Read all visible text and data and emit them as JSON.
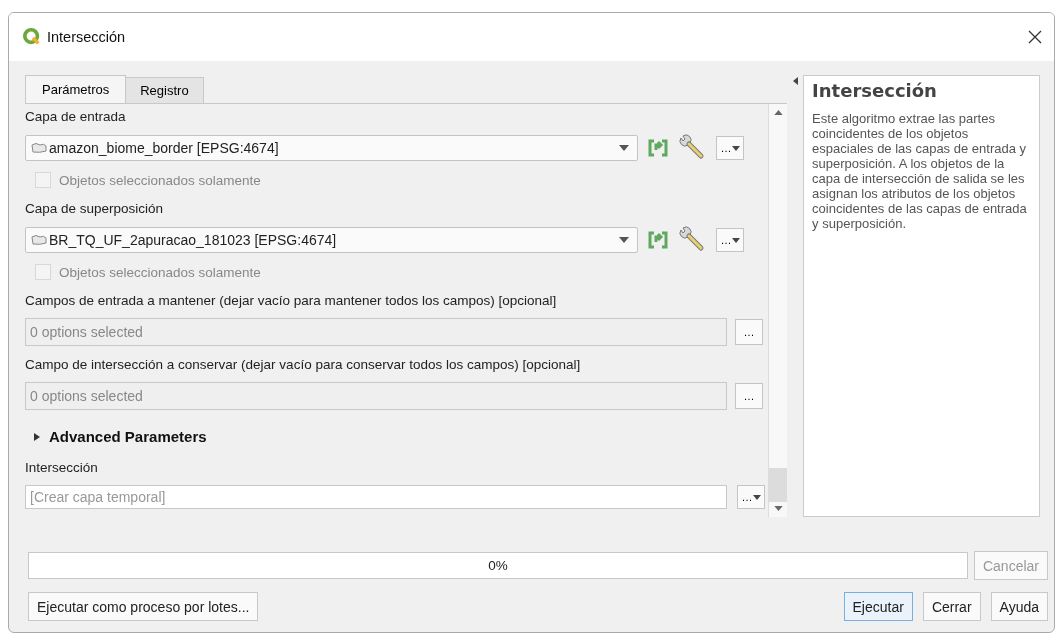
{
  "window": {
    "title": "Intersección"
  },
  "tabs": [
    {
      "label": "Parámetros",
      "selected": true
    },
    {
      "label": "Registro",
      "selected": false
    }
  ],
  "parameters": [
    {
      "kind": "layer",
      "label": "Capa de entrada",
      "value": "amazon_biome_border [EPSG:4674]",
      "button": "…",
      "selected_only": {
        "label": "Objetos seleccionados solamente",
        "checked": false,
        "disabled": true
      }
    },
    {
      "kind": "layer",
      "label": "Capa de superposición",
      "value": "BR_TQ_UF_2apuracao_181023 [EPSG:4674]",
      "button": "…",
      "selected_only": {
        "label": "Objetos seleccionados solamente",
        "checked": false,
        "disabled": true
      }
    },
    {
      "kind": "fields",
      "label": "Campos de entrada a mantener (dejar vacío para mantener todos los campos) [opcional]",
      "value": "0 options selected",
      "button": "…"
    },
    {
      "kind": "fields",
      "label": "Campo de intersección a conservar (dejar vacío para conservar todos los campos) [opcional]",
      "value": "0 options selected",
      "button": "…"
    },
    {
      "kind": "group",
      "label": "Advanced Parameters",
      "expanded": false
    },
    {
      "kind": "output",
      "label": "Intersección",
      "placeholder": "[Crear capa temporal]",
      "button": "…"
    }
  ],
  "help": {
    "title": "Intersección",
    "text": "Este algoritmo extrae las partes coincidentes de los objetos espaciales de las capas de entrada y superposición. A los objetos de la capa de intersección de salida se les asignan los atributos de los objetos coincidentes de las capas de entrada y superposición."
  },
  "progress": {
    "level": 0,
    "reading": "0%"
  },
  "cancel_button": {
    "label": "Cancelar",
    "disabled": true
  },
  "batch_button": {
    "label": "Ejecutar como proceso por lotes..."
  },
  "buttons": [
    {
      "label": "Ejecutar",
      "default": true
    },
    {
      "label": "Cerrar",
      "default": false
    },
    {
      "label": "Ayuda",
      "default": false
    }
  ]
}
